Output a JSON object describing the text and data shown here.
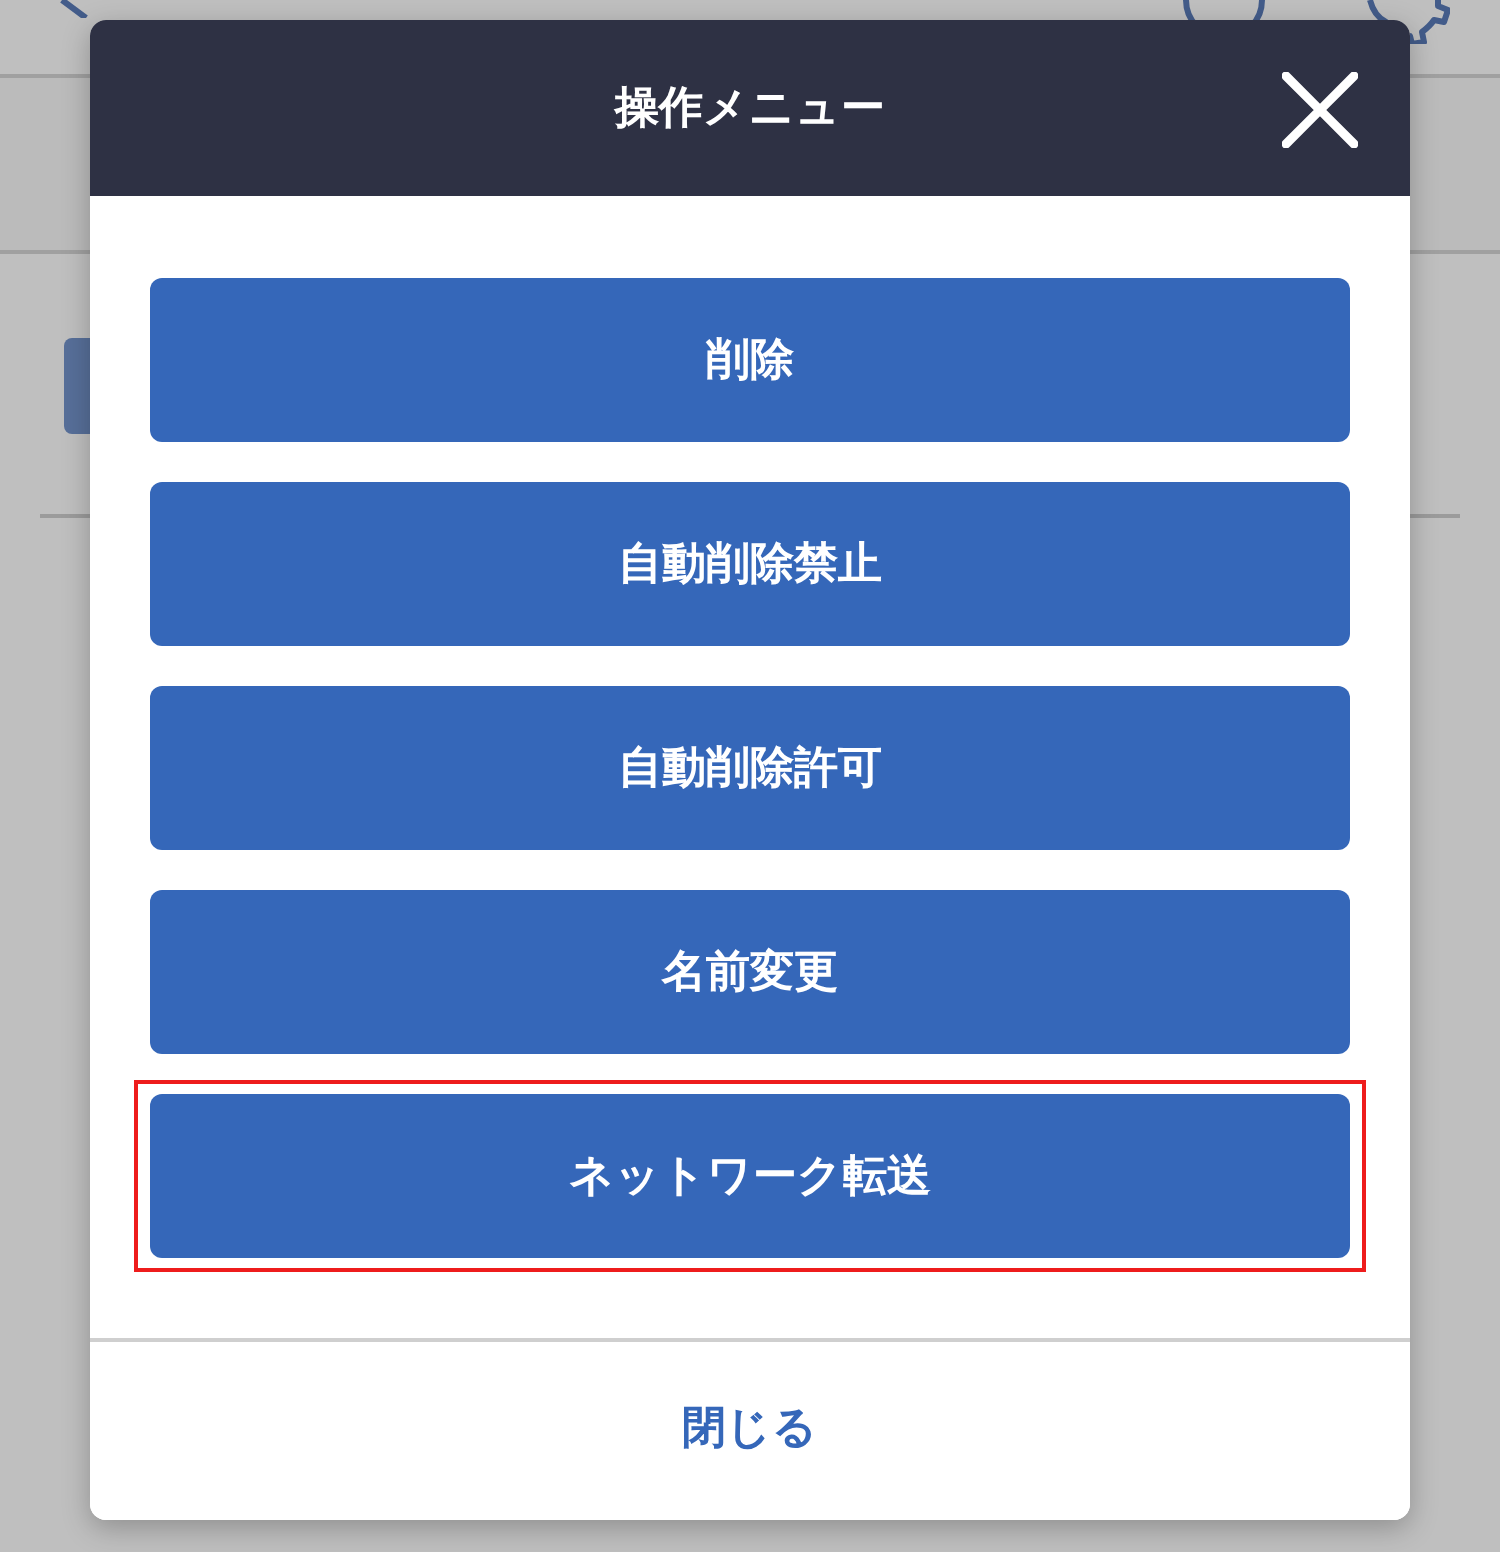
{
  "dialog": {
    "title": "操作メニュー",
    "menu_items": [
      {
        "label": "削除",
        "highlighted": false
      },
      {
        "label": "自動削除禁止",
        "highlighted": false
      },
      {
        "label": "自動削除許可",
        "highlighted": false
      },
      {
        "label": "名前変更",
        "highlighted": false
      },
      {
        "label": "ネットワーク転送",
        "highlighted": true
      }
    ],
    "footer_button": "閉じる"
  }
}
